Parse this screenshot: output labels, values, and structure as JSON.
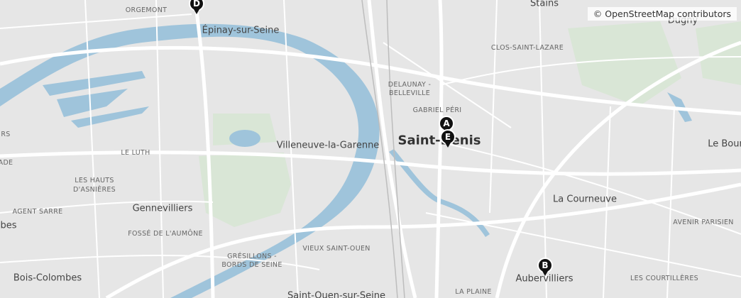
{
  "attribution": "© OpenStreetMap contributors",
  "colors": {
    "water": "#9fc4db",
    "land": "#e6e6e6",
    "road": "#ffffff",
    "park": "#d9e6d6",
    "marker": "#111111"
  },
  "labels": {
    "stains": "Stains",
    "dugny": "Dugny",
    "orgemont": "ORGEMONT",
    "epinay": "Épinay-sur-Seine",
    "clos_saint_lazare": "CLOS-SAINT-LAZARE",
    "delaunay": "DELAUNAY -",
    "belleville": "BELLEVILLE",
    "gabriel_peri": "GABRIEL PÉRI",
    "saint_denis": "Saint-Denis",
    "villeneuve": "Villeneuve-la-Garenne",
    "le_luth": "LE LUTH",
    "rs": "RS",
    "ade": "ADE",
    "hauts_asnieres_1": "LES HAUTS",
    "hauts_asnieres_2": "D'ASNIÈRES",
    "agent_sarre": "AGENT SARRE",
    "gennevilliers": "Gennevilliers",
    "fosse_aumone": "FOSSÉ DE L'AUMÔNE",
    "obes": "obes",
    "bois_colombes": "Bois-Colombes",
    "gresillons_1": "GRÉSILLONS -",
    "gresillons_2": "BORDS DE SEINE",
    "vieux_saint_ouen": "VIEUX SAINT-OUEN",
    "saint_ouen": "Saint-Ouen-sur-Seine",
    "la_courneuve": "La Courneuve",
    "avenir_parisien": "AVENIR PARISIEN",
    "le_bourget": "Le Bour",
    "aubervilliers": "Aubervilliers",
    "courtilleres": "LES COURTILLÈRES",
    "la_plaine": "LA PLAINE"
  },
  "markers": [
    {
      "letter": "A",
      "place": "Saint-Denis"
    },
    {
      "letter": "E",
      "place": "Saint-Denis"
    },
    {
      "letter": "B",
      "place": "Aubervilliers"
    },
    {
      "letter": "D",
      "place": "Orgemont"
    }
  ]
}
